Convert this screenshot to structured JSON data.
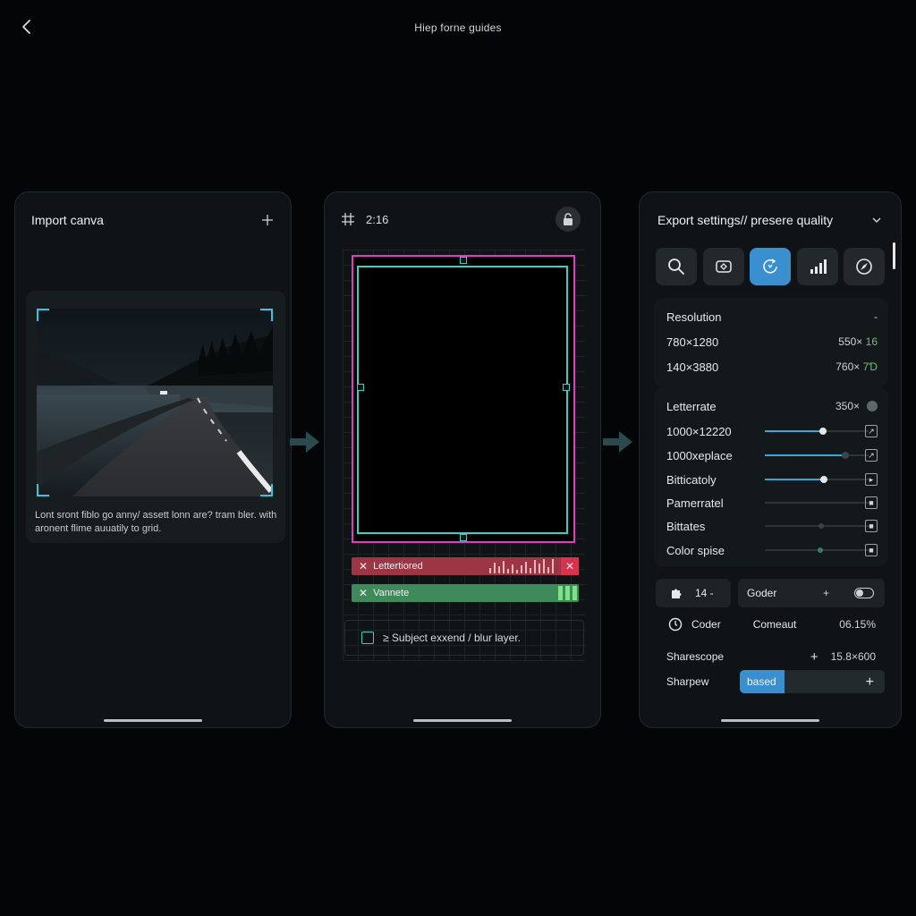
{
  "header": {
    "title": "Hiep forne guides"
  },
  "import_panel": {
    "title": "Import canva",
    "description": "Lont sront fiblo go anny/ assett lonn are? tram bler. with aronent flime auuatily to grid."
  },
  "crop_panel": {
    "ratio": "2:16",
    "tracks": [
      {
        "label": "Lettertiored",
        "color": "#9c3645"
      },
      {
        "label": "Vannete",
        "color": "#3e8a5a"
      }
    ],
    "subject_option": "≥ Subject exxend / blur layer."
  },
  "export_panel": {
    "title": "Export settings// presere quality",
    "tools": [
      "search-icon",
      "crop-icon",
      "rotate-icon",
      "signal-icon",
      "compass-icon"
    ],
    "resolution": {
      "label": "Resolution",
      "marker": "-",
      "rows": [
        {
          "left": "780×1280",
          "right": "550×",
          "right_green": "16"
        },
        {
          "left": "140×3880",
          "right": "760×",
          "right_green": "7Ɗ"
        }
      ]
    },
    "rates": {
      "header_label": "Letterrate",
      "header_value": "350×",
      "items": [
        {
          "label": "1000×12220",
          "level": 0.56
        },
        {
          "label": "1000xeplace",
          "level": 0.78
        },
        {
          "label": "Bitticatoly",
          "level": 0.57
        },
        {
          "label": "Pamerratel",
          "level": null
        },
        {
          "label": "Bittates",
          "level": 0.55
        },
        {
          "label": "Color spise",
          "level": 0.54
        }
      ]
    },
    "codec": {
      "quality_value": "14 -",
      "codec_label": "Goder",
      "plus": "+",
      "coder_label": "Coder",
      "comeaut_label": "Comeaut",
      "percent": "06.15%"
    },
    "sharescope": {
      "label": "Sharescope",
      "value": "15.8×600",
      "plus": "+"
    },
    "sharpew": {
      "label": "Sharpew",
      "fill_text": "based",
      "plus": "+"
    }
  }
}
